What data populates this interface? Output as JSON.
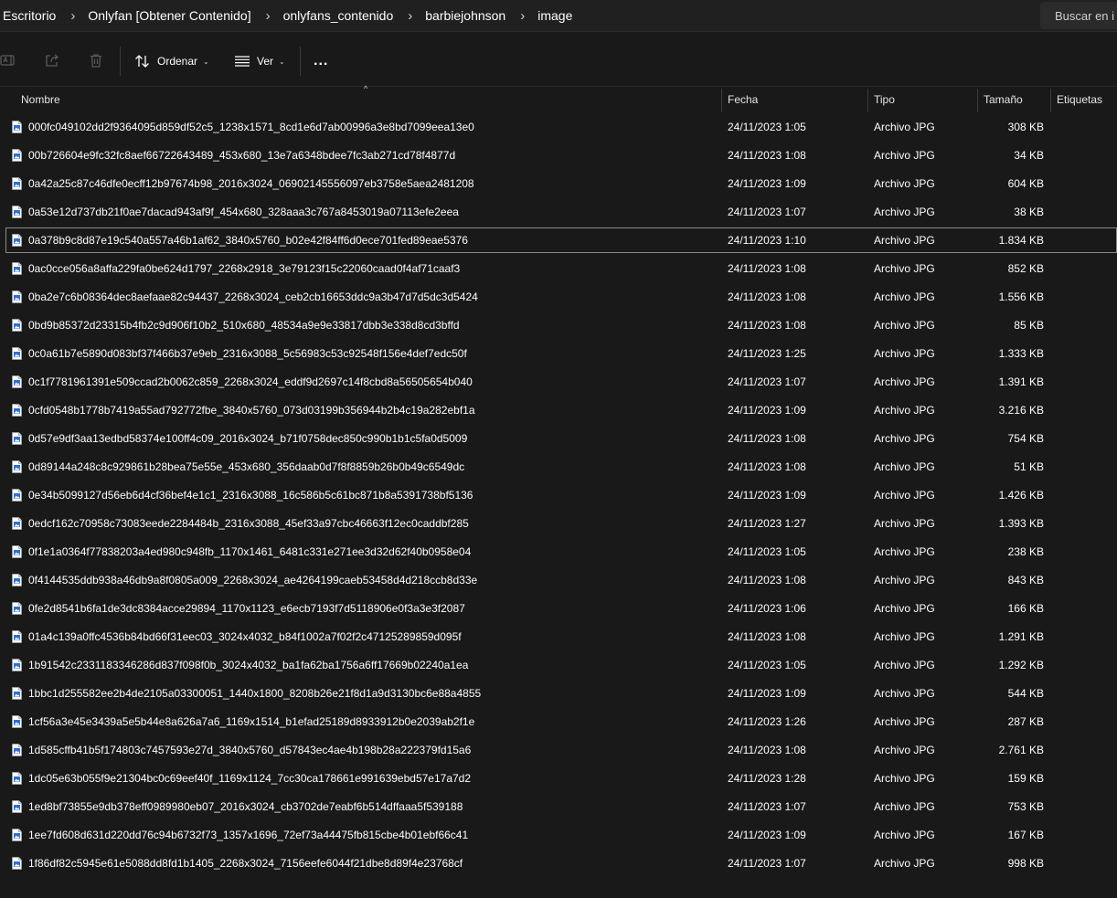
{
  "breadcrumb": [
    "Escritorio",
    "Onlyfan [Obtener Contenido]",
    "onlyfans_contenido",
    "barbiejohnson",
    "image"
  ],
  "search": {
    "placeholder": "Buscar en i"
  },
  "toolbar": {
    "sort_label": "Ordenar",
    "view_label": "Ver",
    "more_label": "..."
  },
  "columns": {
    "name": "Nombre",
    "date": "Fecha",
    "type": "Tipo",
    "size": "Tamaño",
    "tags": "Etiquetas"
  },
  "focused_row": 4,
  "files": [
    {
      "name": "000fc049102dd2f9364095d859df52c5_1238x1571_8cd1e6d7ab00996a3e8bd7099eea13e0",
      "date": "24/11/2023 1:05",
      "type": "Archivo JPG",
      "size": "308 KB"
    },
    {
      "name": "00b726604e9fc32fc8aef66722643489_453x680_13e7a6348bdee7fc3ab271cd78f4877d",
      "date": "24/11/2023 1:08",
      "type": "Archivo JPG",
      "size": "34 KB"
    },
    {
      "name": "0a42a25c87c46dfe0ecff12b97674b98_2016x3024_06902145556097eb3758e5aea2481208",
      "date": "24/11/2023 1:09",
      "type": "Archivo JPG",
      "size": "604 KB"
    },
    {
      "name": "0a53e12d737db21f0ae7dacad943af9f_454x680_328aaa3c767a8453019a07113efe2eea",
      "date": "24/11/2023 1:07",
      "type": "Archivo JPG",
      "size": "38 KB"
    },
    {
      "name": "0a378b9c8d87e19c540a557a46b1af62_3840x5760_b02e42f84ff6d0ece701fed89eae5376",
      "date": "24/11/2023 1:10",
      "type": "Archivo JPG",
      "size": "1.834 KB"
    },
    {
      "name": "0ac0cce056a8affa229fa0be624d1797_2268x2918_3e79123f15c22060caad0f4af71caaf3",
      "date": "24/11/2023 1:08",
      "type": "Archivo JPG",
      "size": "852 KB"
    },
    {
      "name": "0ba2e7c6b08364dec8aefaae82c94437_2268x3024_ceb2cb16653ddc9a3b47d7d5dc3d5424",
      "date": "24/11/2023 1:08",
      "type": "Archivo JPG",
      "size": "1.556 KB"
    },
    {
      "name": "0bd9b85372d23315b4fb2c9d906f10b2_510x680_48534a9e9e33817dbb3e338d8cd3bffd",
      "date": "24/11/2023 1:08",
      "type": "Archivo JPG",
      "size": "85 KB"
    },
    {
      "name": "0c0a61b7e5890d083bf37f466b37e9eb_2316x3088_5c56983c53c92548f156e4def7edc50f",
      "date": "24/11/2023 1:25",
      "type": "Archivo JPG",
      "size": "1.333 KB"
    },
    {
      "name": "0c1f7781961391e509ccad2b0062c859_2268x3024_eddf9d2697c14f8cbd8a56505654b040",
      "date": "24/11/2023 1:07",
      "type": "Archivo JPG",
      "size": "1.391 KB"
    },
    {
      "name": "0cfd0548b1778b7419a55ad792772fbe_3840x5760_073d03199b356944b2b4c19a282ebf1a",
      "date": "24/11/2023 1:09",
      "type": "Archivo JPG",
      "size": "3.216 KB"
    },
    {
      "name": "0d57e9df3aa13edbd58374e100ff4c09_2016x3024_b71f0758dec850c990b1b1c5fa0d5009",
      "date": "24/11/2023 1:08",
      "type": "Archivo JPG",
      "size": "754 KB"
    },
    {
      "name": "0d89144a248c8c929861b28bea75e55e_453x680_356daab0d7f8f8859b26b0b49c6549dc",
      "date": "24/11/2023 1:08",
      "type": "Archivo JPG",
      "size": "51 KB"
    },
    {
      "name": "0e34b5099127d56eb6d4cf36bef4e1c1_2316x3088_16c586b5c61bc871b8a5391738bf5136",
      "date": "24/11/2023 1:09",
      "type": "Archivo JPG",
      "size": "1.426 KB"
    },
    {
      "name": "0edcf162c70958c73083eede2284484b_2316x3088_45ef33a97cbc46663f12ec0caddbf285",
      "date": "24/11/2023 1:27",
      "type": "Archivo JPG",
      "size": "1.393 KB"
    },
    {
      "name": "0f1e1a0364f77838203a4ed980c948fb_1170x1461_6481c331e271ee3d32d62f40b0958e04",
      "date": "24/11/2023 1:05",
      "type": "Archivo JPG",
      "size": "238 KB"
    },
    {
      "name": "0f4144535ddb938a46db9a8f0805a009_2268x3024_ae4264199caeb53458d4d218ccb8d33e",
      "date": "24/11/2023 1:08",
      "type": "Archivo JPG",
      "size": "843 KB"
    },
    {
      "name": "0fe2d8541b6fa1de3dc8384acce29894_1170x1123_e6ecb7193f7d5118906e0f3a3e3f2087",
      "date": "24/11/2023 1:06",
      "type": "Archivo JPG",
      "size": "166 KB"
    },
    {
      "name": "01a4c139a0ffc4536b84bd66f31eec03_3024x4032_b84f1002a7f02f2c47125289859d095f",
      "date": "24/11/2023 1:08",
      "type": "Archivo JPG",
      "size": "1.291 KB"
    },
    {
      "name": "1b91542c2331183346286d837f098f0b_3024x4032_ba1fa62ba1756a6ff17669b02240a1ea",
      "date": "24/11/2023 1:05",
      "type": "Archivo JPG",
      "size": "1.292 KB"
    },
    {
      "name": "1bbc1d255582ee2b4de2105a03300051_1440x1800_8208b26e21f8d1a9d3130bc6e88a4855",
      "date": "24/11/2023 1:09",
      "type": "Archivo JPG",
      "size": "544 KB"
    },
    {
      "name": "1cf56a3e45e3439a5e5b44e8a626a7a6_1169x1514_b1efad25189d8933912b0e2039ab2f1e",
      "date": "24/11/2023 1:26",
      "type": "Archivo JPG",
      "size": "287 KB"
    },
    {
      "name": "1d585cffb41b5f174803c7457593e27d_3840x5760_d57843ec4ae4b198b28a222379fd15a6",
      "date": "24/11/2023 1:08",
      "type": "Archivo JPG",
      "size": "2.761 KB"
    },
    {
      "name": "1dc05e63b055f9e21304bc0c69eef40f_1169x1124_7cc30ca178661e991639ebd57e17a7d2",
      "date": "24/11/2023 1:28",
      "type": "Archivo JPG",
      "size": "159 KB"
    },
    {
      "name": "1ed8bf73855e9db378eff0989980eb07_2016x3024_cb3702de7eabf6b514dffaaa5f539188",
      "date": "24/11/2023 1:07",
      "type": "Archivo JPG",
      "size": "753 KB"
    },
    {
      "name": "1ee7fd608d631d220dd76c94b6732f73_1357x1696_72ef73a44475fb815cbe4b01ebf66c41",
      "date": "24/11/2023 1:09",
      "type": "Archivo JPG",
      "size": "167 KB"
    },
    {
      "name": "1f86df82c5945e61e5088dd8fd1b1405_2268x3024_7156eefe6044f21dbe8d89f4e23768cf",
      "date": "24/11/2023 1:07",
      "type": "Archivo JPG",
      "size": "998 KB"
    }
  ]
}
